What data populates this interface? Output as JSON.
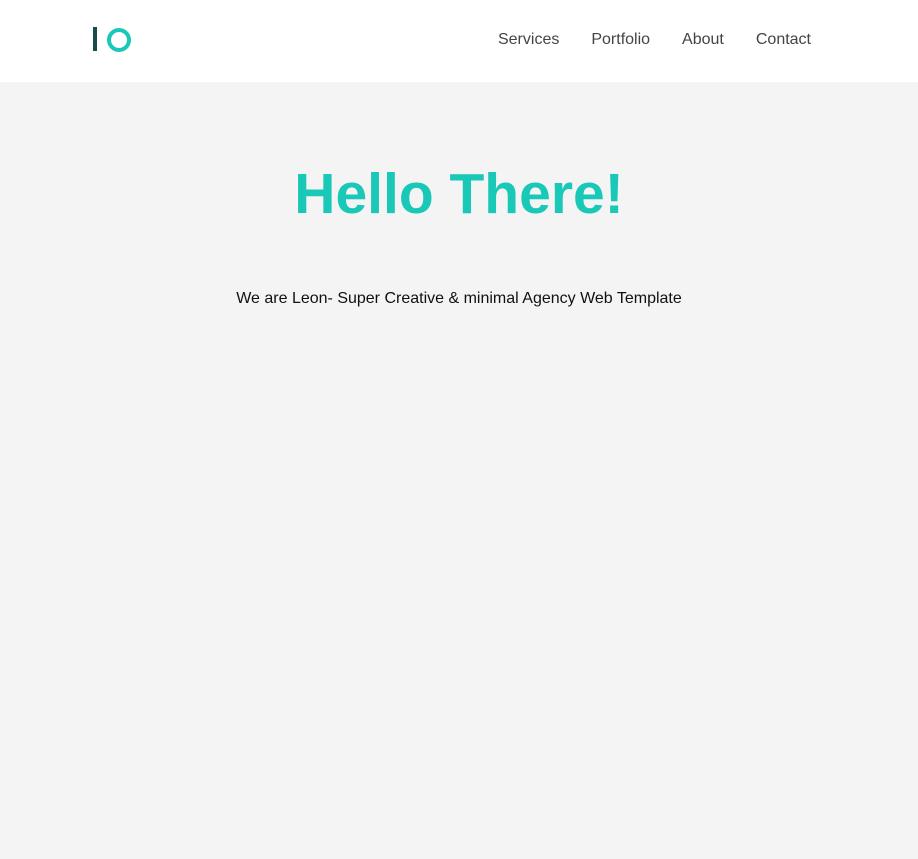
{
  "header": {
    "logo_icon": "io-logo-icon",
    "nav": [
      {
        "label": "Services"
      },
      {
        "label": "Portfolio"
      },
      {
        "label": "About"
      },
      {
        "label": "Contact"
      }
    ]
  },
  "hero": {
    "title": "Hello There!",
    "subtitle": "We are Leon- Super Creative & minimal Agency Web Template"
  },
  "colors": {
    "accent": "#19c8b7",
    "logo_dark": "#174a4f",
    "header_bg": "#ffffff",
    "page_bg": "#f4f4f4",
    "nav_text": "#444444",
    "body_text": "#111111"
  }
}
